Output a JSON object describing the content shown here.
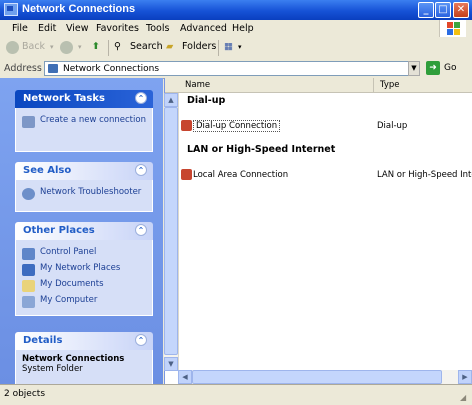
{
  "window": {
    "title": "Network Connections",
    "min": "_",
    "max": "□",
    "close": "✕"
  },
  "menu": [
    {
      "label": "File"
    },
    {
      "label": "Edit"
    },
    {
      "label": "View"
    },
    {
      "label": "Favorites"
    },
    {
      "label": "Tools"
    },
    {
      "label": "Advanced"
    },
    {
      "label": "Help"
    }
  ],
  "toolbar": {
    "back": "Back",
    "search": "Search",
    "folders": "Folders"
  },
  "address": {
    "label": "Address",
    "value": "Network Connections",
    "go": "Go"
  },
  "left": {
    "network_tasks": {
      "title": "Network Tasks",
      "items": [
        "Create a new connection"
      ]
    },
    "see_also": {
      "title": "See Also",
      "items": [
        "Network Troubleshooter"
      ]
    },
    "other_places": {
      "title": "Other Places",
      "items": [
        "Control Panel",
        "My Network Places",
        "My Documents",
        "My Computer"
      ]
    },
    "details": {
      "title": "Details",
      "name": "Network Connections",
      "type": "System Folder"
    }
  },
  "columns": {
    "name": "Name",
    "type": "Type"
  },
  "groups": [
    {
      "title": "Dial-up",
      "items": [
        {
          "name": "Dial-up Connection",
          "type": "Dial-up"
        }
      ]
    },
    {
      "title": "LAN or High-Speed Internet",
      "items": [
        {
          "name": "Local Area Connection",
          "type": "LAN or High-Speed Internet"
        }
      ]
    }
  ],
  "status": {
    "text": "2 objects"
  },
  "colors": {
    "title_bar": "#1652d6",
    "task_pane": "#6b8fe3",
    "panel_body": "#d6dff7"
  }
}
